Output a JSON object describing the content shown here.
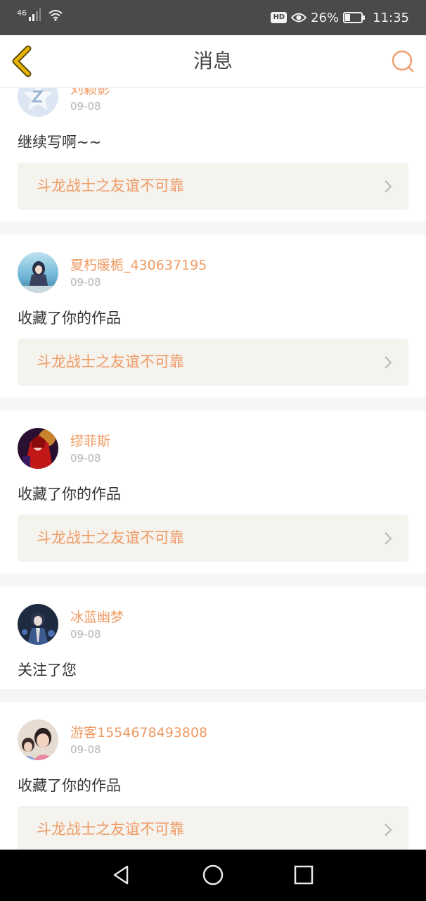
{
  "status_bar": {
    "network": "46",
    "battery": "26%",
    "time": "11:35",
    "hd_label": "HD"
  },
  "header": {
    "title": "消息"
  },
  "messages": [
    {
      "username": "刘颖影",
      "date": "09-08",
      "text": "继续写啊~~",
      "link": "斗龙战士之友谊不可靠",
      "avatar_icon": "default-avatar-icon"
    },
    {
      "username": "夏朽暖栀_430637195",
      "date": "09-08",
      "text": "收藏了你的作品",
      "link": "斗龙战士之友谊不可靠",
      "avatar_icon": "anime-girl-avatar"
    },
    {
      "username": "缪菲斯",
      "date": "09-08",
      "text": "收藏了你的作品",
      "link": "斗龙战士之友谊不可靠",
      "avatar_icon": "red-character-avatar"
    },
    {
      "username": "冰蓝幽梦",
      "date": "09-08",
      "text": "关注了您",
      "avatar_icon": "dark-character-avatar"
    },
    {
      "username": "游客1554678493808",
      "date": "09-08",
      "text": "收藏了你的作品",
      "link": "斗龙战士之友谊不可靠",
      "avatar_icon": "photo-avatar"
    }
  ],
  "colors": {
    "accent": "#ee9a62",
    "link_bg": "#f4f3ee",
    "status_bar": "#4a4a4a",
    "back_icon": "#e6b400"
  },
  "nav": {
    "back_icon": "triangle-back-icon",
    "home_icon": "circle-home-icon",
    "recents_icon": "square-recents-icon"
  }
}
